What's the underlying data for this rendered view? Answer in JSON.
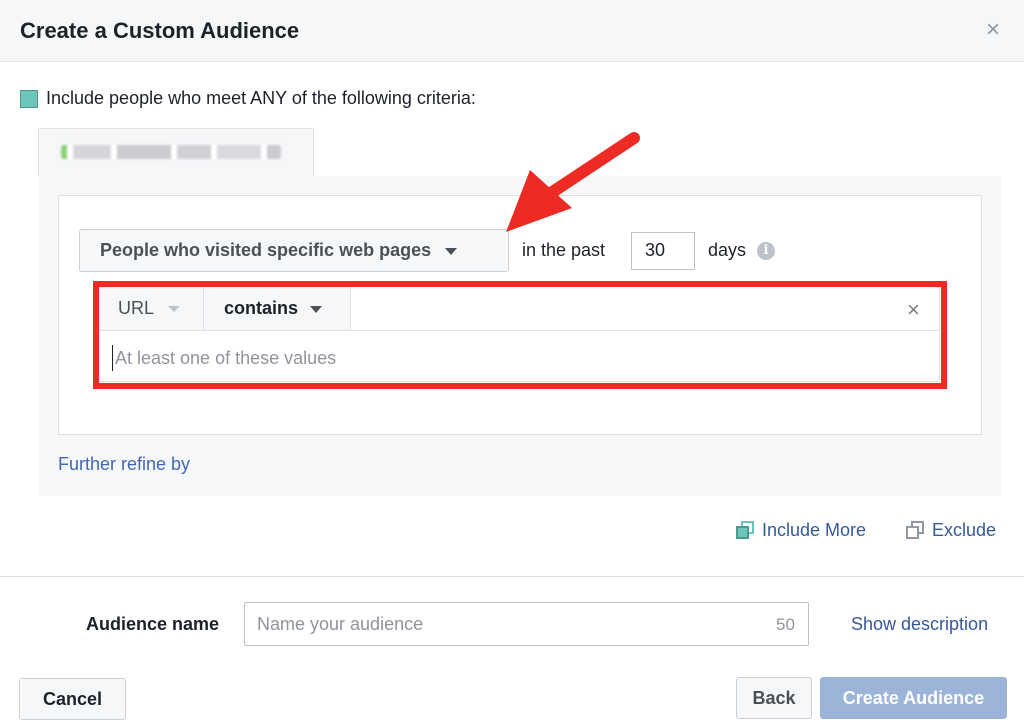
{
  "dialog": {
    "title": "Create a Custom Audience",
    "close_glyph": "×"
  },
  "criteria": {
    "text": "Include people who meet ANY of the following criteria:"
  },
  "rule": {
    "visit_dropdown": "People who visited specific web pages",
    "in_the_past_label": "in the past",
    "days_value": "30",
    "days_label": "days",
    "info_glyph": "i",
    "url_dropdown": "URL",
    "operator_dropdown": "contains",
    "remove_glyph": "×",
    "values_placeholder": "At least one of these values",
    "further_refine": "Further refine by"
  },
  "actions": {
    "include_more": "Include More",
    "exclude": "Exclude"
  },
  "audience": {
    "label": "Audience name",
    "placeholder": "Name your audience",
    "char_count": "50",
    "show_description": "Show description"
  },
  "footer": {
    "cancel": "Cancel",
    "back": "Back",
    "create": "Create Audience"
  },
  "colors": {
    "accent_red": "#ee2a24",
    "link_blue": "#365899",
    "primary_disabled": "#9cb4d8",
    "teal_swatch": "#6bc5b8"
  }
}
